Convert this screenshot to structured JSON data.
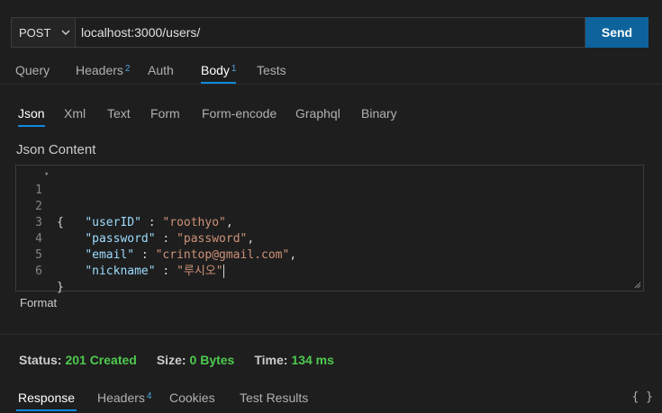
{
  "request": {
    "method": "POST",
    "url": "localhost:3000/users/",
    "send_label": "Send"
  },
  "tabs": [
    {
      "label": "Query",
      "badge": ""
    },
    {
      "label": "Headers",
      "badge": "2"
    },
    {
      "label": "Auth",
      "badge": ""
    },
    {
      "label": "Body",
      "badge": "1"
    },
    {
      "label": "Tests",
      "badge": ""
    }
  ],
  "body_tabs": [
    "Json",
    "Xml",
    "Text",
    "Form",
    "Form-encode",
    "Graphql",
    "Binary"
  ],
  "json_content_title": "Json Content",
  "editor": {
    "line_numbers": [
      "1",
      "2",
      "3",
      "4",
      "5",
      "6"
    ],
    "lines": {
      "l1": "{",
      "k2": "\"userID\"",
      "v2": "\"roothyo\"",
      "k3": "\"password\"",
      "v3": "\"password\"",
      "k4": "\"email\"",
      "v4": "\"crintop@gmail.com\"",
      "k5": "\"nickname\"",
      "v5": "\"루시오\"",
      "l6": "}"
    }
  },
  "format_label": "Format",
  "status": {
    "status_label": "Status:",
    "status_value": "201 Created",
    "size_label": "Size:",
    "size_value": "0 Bytes",
    "time_label": "Time:",
    "time_value": "134 ms"
  },
  "response_tabs": [
    {
      "label": "Response",
      "badge": ""
    },
    {
      "label": "Headers",
      "badge": "4"
    },
    {
      "label": "Cookies",
      "badge": ""
    },
    {
      "label": "Test Results",
      "badge": ""
    }
  ],
  "braces_label": "{ }",
  "icons": {
    "method_dropdown": "chevron-down-icon",
    "resize": "resize-handle-icon"
  },
  "colors": {
    "accent": "#0e639c",
    "success": "#4ec94e",
    "tab_underline": "#0e89e0"
  }
}
